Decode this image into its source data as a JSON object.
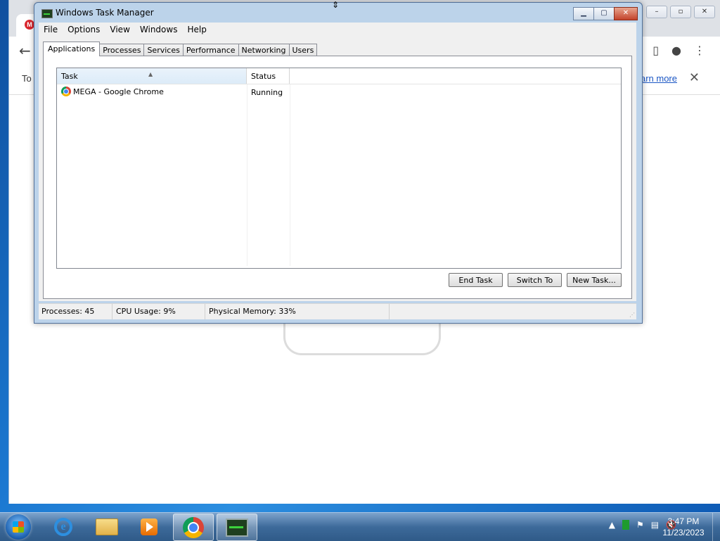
{
  "background_chrome": {
    "favicon_letter": "M",
    "infobar_prefix": "To",
    "infobar_link": "arn more"
  },
  "window": {
    "title": "Windows Task Manager",
    "menu": [
      "File",
      "Options",
      "View",
      "Windows",
      "Help"
    ]
  },
  "tabs": [
    "Applications",
    "Processes",
    "Services",
    "Performance",
    "Networking",
    "Users"
  ],
  "active_tab": "Applications",
  "list": {
    "columns": [
      "Task",
      "Status"
    ],
    "rows": [
      {
        "task": "MEGA - Google Chrome",
        "status": "Running"
      }
    ]
  },
  "buttons": {
    "end_task": "End Task",
    "switch_to": "Switch To",
    "new_task": "New Task..."
  },
  "statusbar": {
    "processes": "Processes: 45",
    "cpu": "CPU Usage: 9%",
    "memory": "Physical Memory: 33%"
  },
  "taskbar": {
    "time": "3:47 PM",
    "date": "11/23/2023"
  },
  "colors": {
    "mega_red": "#d9272e",
    "titlebar": "#bcd3ea",
    "taskbar": "#3d6a9a"
  }
}
